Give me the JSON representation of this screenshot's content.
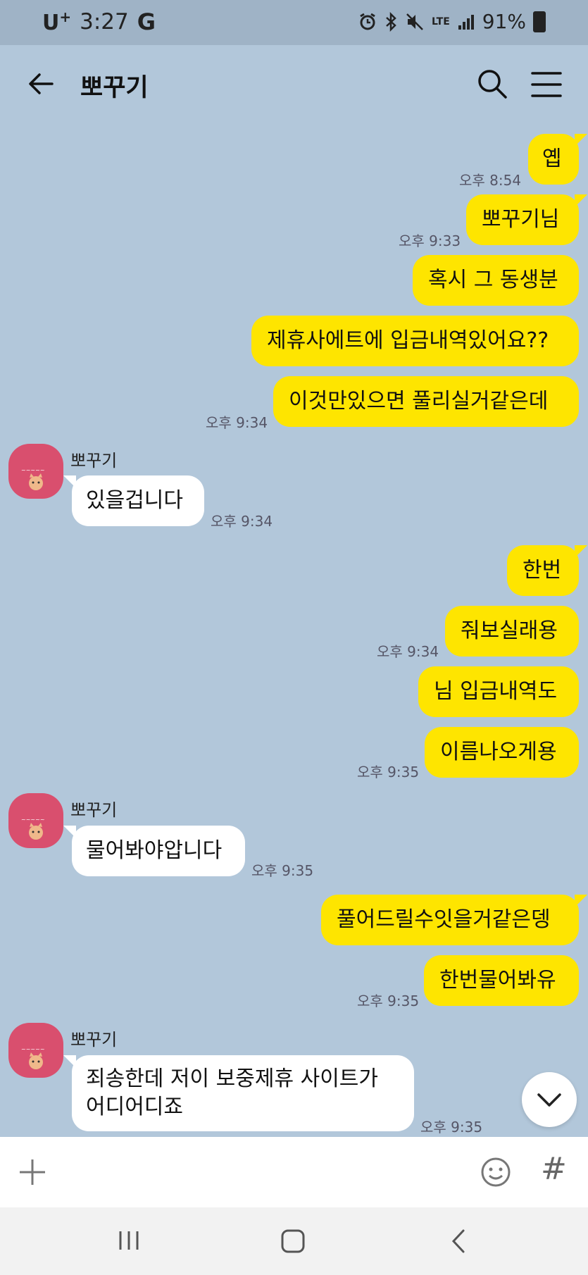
{
  "status_bar": {
    "carrier": "U",
    "carrier_sup": "+",
    "time": "3:27",
    "g_icon": "G",
    "network": "LTE",
    "battery": "91%"
  },
  "header": {
    "title": "뽀꾸기"
  },
  "messages": [
    {
      "side": "mine",
      "text": "옙",
      "time": "오후 8:54"
    },
    {
      "side": "mine",
      "text": "뽀꾸기님",
      "time": "오후 9:33"
    },
    {
      "side": "mine",
      "text": "혹시 그 동생분",
      "time": ""
    },
    {
      "side": "mine",
      "text": "제휴사에트에 입금내역있어요??",
      "time": ""
    },
    {
      "side": "mine",
      "text": "이것만있으면 풀리실거같은데",
      "time": "오후 9:34"
    },
    {
      "side": "theirs",
      "sender": "뽀꾸기",
      "text": "있을겁니다",
      "time": "오후 9:34"
    },
    {
      "side": "mine",
      "text": "한번",
      "time": ""
    },
    {
      "side": "mine",
      "text": "줘보실래용",
      "time": "오후 9:34"
    },
    {
      "side": "mine",
      "text": "님 입금내역도",
      "time": ""
    },
    {
      "side": "mine",
      "text": "이름나오게용",
      "time": "오후 9:35"
    },
    {
      "side": "theirs",
      "sender": "뽀꾸기",
      "text": "물어봐야압니다",
      "time": "오후 9:35"
    },
    {
      "side": "mine",
      "text": "풀어드릴수잇을거같은뎅",
      "time": ""
    },
    {
      "side": "mine",
      "text": "한번물어봐유",
      "time": "오후 9:35"
    },
    {
      "side": "theirs",
      "sender": "뽀꾸기",
      "text_line1": "죄송한데 저이 보중제휴 사이트가",
      "text_line2": "어디어디죠",
      "time": "오후 9:35"
    }
  ],
  "icons": {
    "back": "arrow-left-icon",
    "search": "search-icon",
    "menu": "hamburger-menu-icon",
    "scroll_down": "chevron-down-icon",
    "plus": "plus-icon",
    "emoji": "emoji-icon",
    "hash": "#"
  },
  "colors": {
    "chat_bg": "#b2c7da",
    "my_bubble": "#fee500",
    "their_bubble": "#ffffff",
    "avatar": "#d94f6e"
  }
}
